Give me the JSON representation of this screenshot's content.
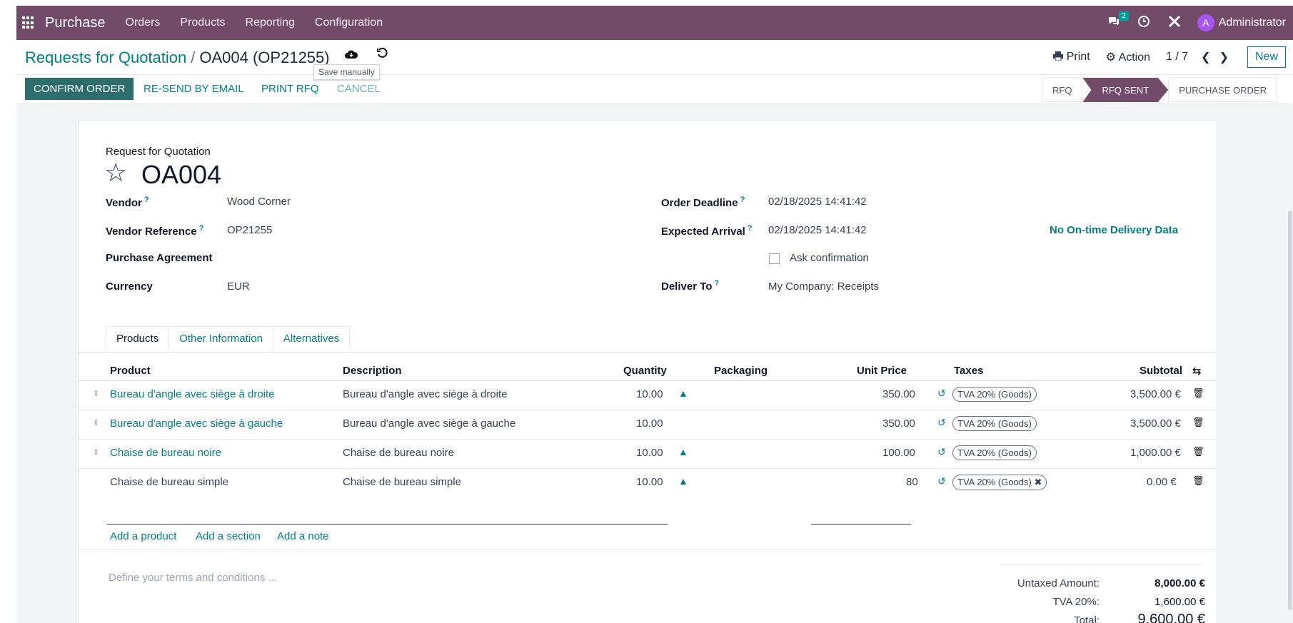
{
  "nav": {
    "app_name": "Purchase",
    "menu": [
      "Orders",
      "Products",
      "Reporting",
      "Configuration"
    ],
    "messages_badge": "2",
    "avatar_letter": "A",
    "user": "Administrator"
  },
  "control": {
    "breadcrumb_parent": "Requests for Quotation",
    "breadcrumb_sep": "/",
    "breadcrumb_current": "OA004 (OP21255)",
    "tooltip": "Save manually",
    "print": "Print",
    "action": "Action",
    "pager": "1 / 7",
    "new": "New"
  },
  "statusbar": {
    "confirm": "CONFIRM ORDER",
    "resend": "RE-SEND BY EMAIL",
    "print_rfq": "PRINT RFQ",
    "cancel": "CANCEL",
    "stages": [
      "RFQ",
      "RFQ SENT",
      "PURCHASE ORDER"
    ],
    "active_stage": "RFQ SENT"
  },
  "form": {
    "subtitle": "Request for Quotation",
    "name": "OA004",
    "vendor_label": "Vendor",
    "vendor": "Wood Corner",
    "vendor_ref_label": "Vendor Reference",
    "vendor_ref": "OP21255",
    "agreement_label": "Purchase Agreement",
    "currency_label": "Currency",
    "currency": "EUR",
    "deadline_label": "Order Deadline",
    "deadline": "02/18/2025 14:41:42",
    "arrival_label": "Expected Arrival",
    "arrival": "02/18/2025 14:41:42",
    "ask_confirmation": "Ask confirmation",
    "deliver_label": "Deliver To",
    "deliver": "My Company: Receipts",
    "ontime": "No On-time Delivery Data",
    "help": "?"
  },
  "tabs": [
    "Products",
    "Other Information",
    "Alternatives"
  ],
  "table": {
    "headers": {
      "product": "Product",
      "description": "Description",
      "quantity": "Quantity",
      "packaging": "Packaging",
      "unit_price": "Unit Price",
      "taxes": "Taxes",
      "subtotal": "Subtotal"
    },
    "rows": [
      {
        "product": "Bureau d'angle avec siège à droite",
        "description": "Bureau d'angle avec siège à droite",
        "quantity": "10.00",
        "price": "350.00",
        "tax": "TVA 20% (Goods)",
        "subtotal": "3,500.00 €"
      },
      {
        "product": "Bureau d'angle avec siège à gauche",
        "description": "Bureau d'angle avec siège à gauche",
        "quantity": "10.00",
        "price": "350.00",
        "tax": "TVA 20% (Goods)",
        "subtotal": "3,500.00 €"
      },
      {
        "product": "Chaise de bureau noire",
        "description": "Chaise de bureau noire",
        "quantity": "10.00",
        "price": "100.00",
        "tax": "TVA 20% (Goods)",
        "subtotal": "1,000.00 €"
      },
      {
        "product": "Chaise de bureau simple",
        "description": "Chaise de bureau simple",
        "quantity": "10.00",
        "price": "80",
        "tax": "TVA 20% (Goods)",
        "subtotal": "0.00 €"
      }
    ],
    "add_product": "Add a product",
    "add_section": "Add a section",
    "add_note": "Add a note"
  },
  "footer": {
    "terms_placeholder": "Define your terms and conditions ...",
    "untaxed_label": "Untaxed Amount:",
    "untaxed": "8,000.00 €",
    "tva_label": "TVA 20%:",
    "tva": "1,600.00 €",
    "total_label": "Total:",
    "total": "9,600.00 €"
  },
  "colors": {
    "brand": "#714b67",
    "accent": "#017e84",
    "primary_button": "#2c6e6e"
  }
}
